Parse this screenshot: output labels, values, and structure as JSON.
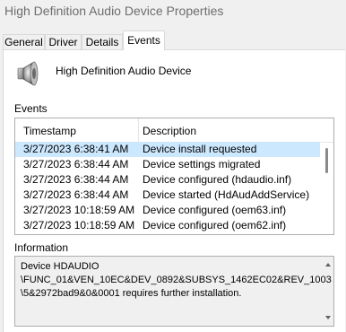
{
  "window": {
    "title": "High Definition Audio Device Properties"
  },
  "tabs": [
    {
      "label": "General",
      "active": false
    },
    {
      "label": "Driver",
      "active": false
    },
    {
      "label": "Details",
      "active": false
    },
    {
      "label": "Events",
      "active": true
    }
  ],
  "device": {
    "icon": "speaker-icon",
    "name": "High Definition Audio Device"
  },
  "events": {
    "label": "Events",
    "columns": {
      "timestamp": "Timestamp",
      "description": "Description"
    },
    "rows": [
      {
        "timestamp": "3/27/2023 6:38:41 AM",
        "description": "Device install requested"
      },
      {
        "timestamp": "3/27/2023 6:38:44 AM",
        "description": "Device settings migrated"
      },
      {
        "timestamp": "3/27/2023 6:38:44 AM",
        "description": "Device configured (hdaudio.inf)"
      },
      {
        "timestamp": "3/27/2023 6:38:44 AM",
        "description": "Device started (HdAudAddService)"
      },
      {
        "timestamp": "3/27/2023 10:18:59 AM",
        "description": "Device configured (oem63.inf)"
      },
      {
        "timestamp": "3/27/2023 10:18:59 AM",
        "description": "Device configured (oem62.inf)"
      }
    ],
    "selected_index": 0
  },
  "information": {
    "label": "Information",
    "lines": [
      "Device HDAUDIO",
      "\\FUNC_01&VEN_10EC&DEV_0892&SUBSYS_1462EC02&REV_1003",
      "\\5&2972bad9&0&0001 requires further installation."
    ]
  }
}
